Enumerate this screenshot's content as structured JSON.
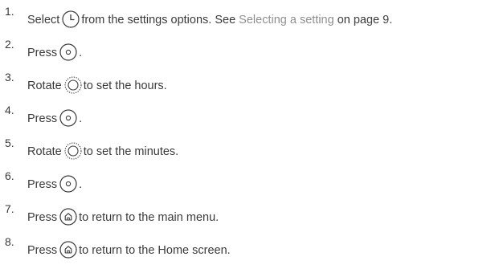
{
  "steps": [
    {
      "num": "1.",
      "before": "Select",
      "icon": "clock-icon",
      "after_a": "from the settings options. See",
      "link": "Selecting a setting",
      "after_b": "on page 9."
    },
    {
      "num": "2.",
      "before": "Press",
      "icon": "select-button-icon",
      "after": "."
    },
    {
      "num": "3.",
      "before": "Rotate",
      "icon": "rotary-dial-icon",
      "after": "to set the hours."
    },
    {
      "num": "4.",
      "before": "Press",
      "icon": "select-button-icon",
      "after": "."
    },
    {
      "num": "5.",
      "before": "Rotate",
      "icon": "rotary-dial-icon",
      "after": "to set the minutes."
    },
    {
      "num": "6.",
      "before": "Press",
      "icon": "select-button-icon",
      "after": "."
    },
    {
      "num": "7.",
      "before": "Press",
      "icon": "home-button-icon",
      "after": "to return to the main menu."
    },
    {
      "num": "8.",
      "before": "Press",
      "icon": "home-button-icon",
      "after": "to return to the Home screen."
    }
  ],
  "colors": {
    "text": "#3a3a3a",
    "link": "#8f8f8f"
  }
}
